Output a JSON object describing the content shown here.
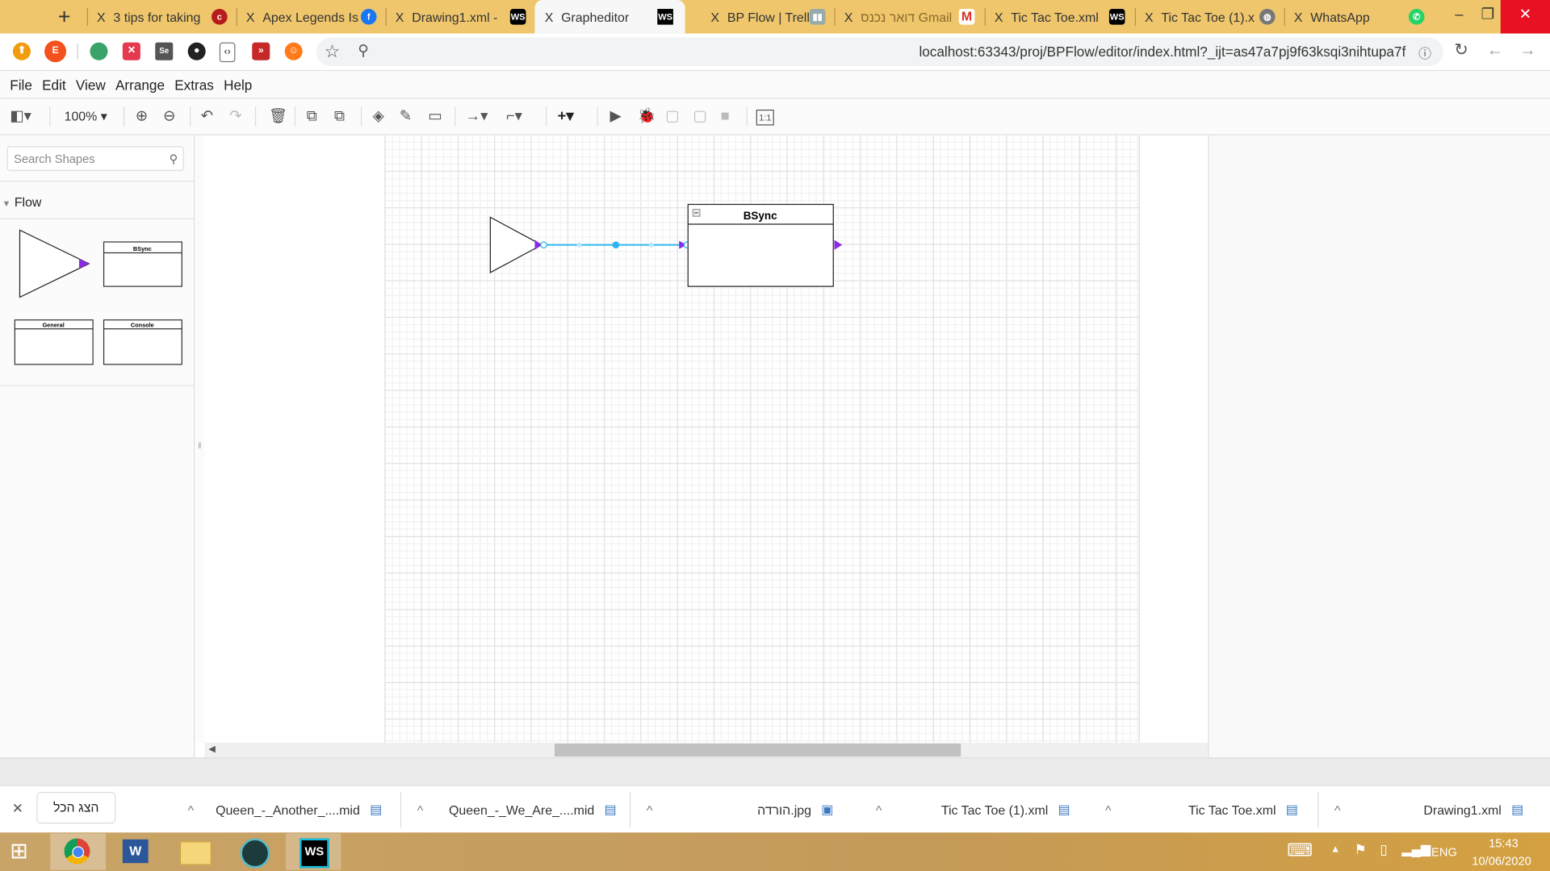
{
  "browser": {
    "tabs": [
      {
        "title": "3 tips for taking",
        "icon": "cnet-icon",
        "color": "#b71c1c"
      },
      {
        "title": "Apex Legends Is",
        "icon": "facebook-icon",
        "color": "#1877f2"
      },
      {
        "title": "Drawing1.xml -",
        "icon": "webstorm-icon",
        "color": "#000000"
      },
      {
        "title": "Grapheditor",
        "icon": "webstorm-icon",
        "color": "#000000",
        "active": true
      },
      {
        "title": "BP Flow | Trello",
        "icon": "trello-icon",
        "color": "#9aa"
      },
      {
        "title": "דואר נכנס Gmail",
        "icon": "gmail-icon",
        "color": "#d93025"
      },
      {
        "title": "Tic Tac Toe.xml",
        "icon": "webstorm-icon",
        "color": "#000000"
      },
      {
        "title": "Tic Tac Toe (1).x",
        "icon": "globe-icon",
        "color": "#777"
      },
      {
        "title": "WhatsApp",
        "icon": "whatsapp-icon",
        "color": "#25d366"
      }
    ],
    "new_tab": "+",
    "close_glyph": "X",
    "url": "localhost:63343/proj/BPFlow/editor/index.html?_ijt=as47a7pj9f63ksqi3nihtupa7f",
    "extension_e": "E"
  },
  "menu": [
    "File",
    "Edit",
    "View",
    "Arrange",
    "Extras",
    "Help"
  ],
  "toolbar": {
    "zoom": "100%",
    "fit_label": "1:1"
  },
  "sidebar": {
    "search_placeholder": "Search Shapes",
    "section": "Flow",
    "shapes": [
      "BSync",
      "General",
      "Console"
    ]
  },
  "diagram": {
    "node_title": "BSync",
    "accent": "#8a2be2",
    "edge_color": "#29b6f2"
  },
  "downloads": {
    "show_all": "הצג הכל",
    "items": [
      "Queen_-_Another_....mid",
      "Queen_-_We_Are_....mid",
      "הורדה.jpg",
      "Tic Tac Toe (1).xml",
      "Tic Tac Toe.xml",
      "Drawing1.xml"
    ]
  },
  "taskbar": {
    "lang": "ENG",
    "time": "15:43",
    "date": "10/06/2020"
  }
}
